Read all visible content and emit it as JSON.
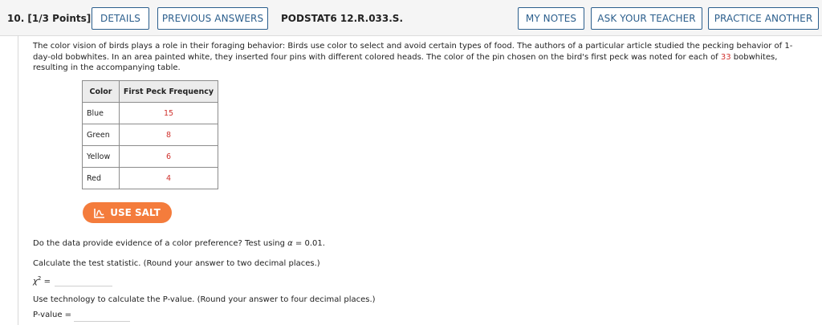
{
  "header": {
    "question_number": "10. [1/3 Points]",
    "details_label": "DETAILS",
    "previous_answers_label": "PREVIOUS ANSWERS",
    "problem_code": "PODSTAT6 12.R.033.S.",
    "my_notes_label": "MY NOTES",
    "ask_teacher_label": "ASK YOUR TEACHER",
    "practice_another_label": "PRACTICE ANOTHER"
  },
  "question": {
    "text_before_n": "The color vision of birds plays a role in their foraging behavior: Birds use color to select and avoid certain types of food. The authors of a particular article studied the pecking behavior of 1-day-old bobwhites. In an area painted white, they inserted four pins with different colored heads. The color of the pin chosen on the bird's first peck was noted for each of ",
    "n": "33",
    "text_after_n": " bobwhites, resulting in the accompanying table."
  },
  "table": {
    "headers": [
      "Color",
      "First Peck Frequency"
    ],
    "rows": [
      {
        "color": "Blue",
        "frequency": "15"
      },
      {
        "color": "Green",
        "frequency": "8"
      },
      {
        "color": "Yellow",
        "frequency": "6"
      },
      {
        "color": "Red",
        "frequency": "4"
      }
    ]
  },
  "salt_button": {
    "label": "USE SALT",
    "icon": "salt-chart-icon",
    "color": "#f47c3c"
  },
  "prompts": {
    "evidence": "Do the data provide evidence of a color preference? Test using",
    "alpha_symbol": "α",
    "alpha_value": "= 0.01.",
    "statistic_instruction": "Calculate the test statistic. (Round your answer to two decimal places.)",
    "chi_label": "χ",
    "chi_sup": "2",
    "chi_eq": " =",
    "chi_value": "",
    "pvalue_instruction": "Use technology to calculate the P-value. (Round your answer to four decimal places.)",
    "pvalue_label": "P-value =",
    "pvalue_value": ""
  },
  "colors": {
    "accent": "#2c5f8d",
    "highlight": "#d0312d"
  }
}
